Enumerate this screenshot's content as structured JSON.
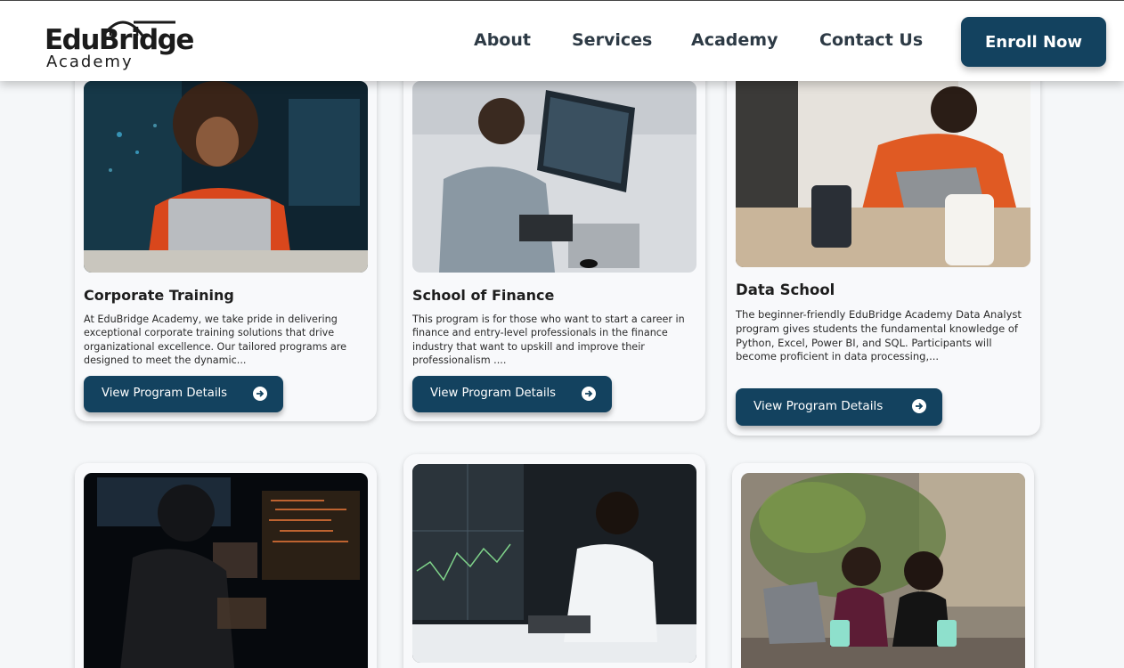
{
  "brand": {
    "name": "EduBridge",
    "sub": "Academy"
  },
  "nav": {
    "items": [
      {
        "label": "About"
      },
      {
        "label": "Services"
      },
      {
        "label": "Academy"
      },
      {
        "label": "Contact Us"
      }
    ],
    "cta": "Enroll Now"
  },
  "colors": {
    "primary": "#13425f",
    "background": "#f5f7f9"
  },
  "cards": [
    {
      "title": "Corporate Training",
      "description": "At EduBridge Academy, we take pride in delivering exceptional corporate training solutions that drive organizational excellence. Our tailored programs are designed to meet the dynamic...",
      "button": "View Program Details",
      "button_icon": "arrow-right-circle-icon"
    },
    {
      "title": "School of Finance",
      "description": "This program is for those who want to start a career in finance and entry-level professionals in the finance industry that want to upskill and improve their professionalism ....",
      "button": "View Program Details",
      "button_icon": "arrow-right-circle-icon"
    },
    {
      "title": "Data School",
      "description": "The beginner-friendly EduBridge Academy Data Analyst program gives students the fundamental knowledge of Python, Excel, Power BI, and SQL. Participants will become proficient in data processing,...",
      "button": "View Program Details",
      "button_icon": "arrow-right-circle-icon"
    }
  ]
}
